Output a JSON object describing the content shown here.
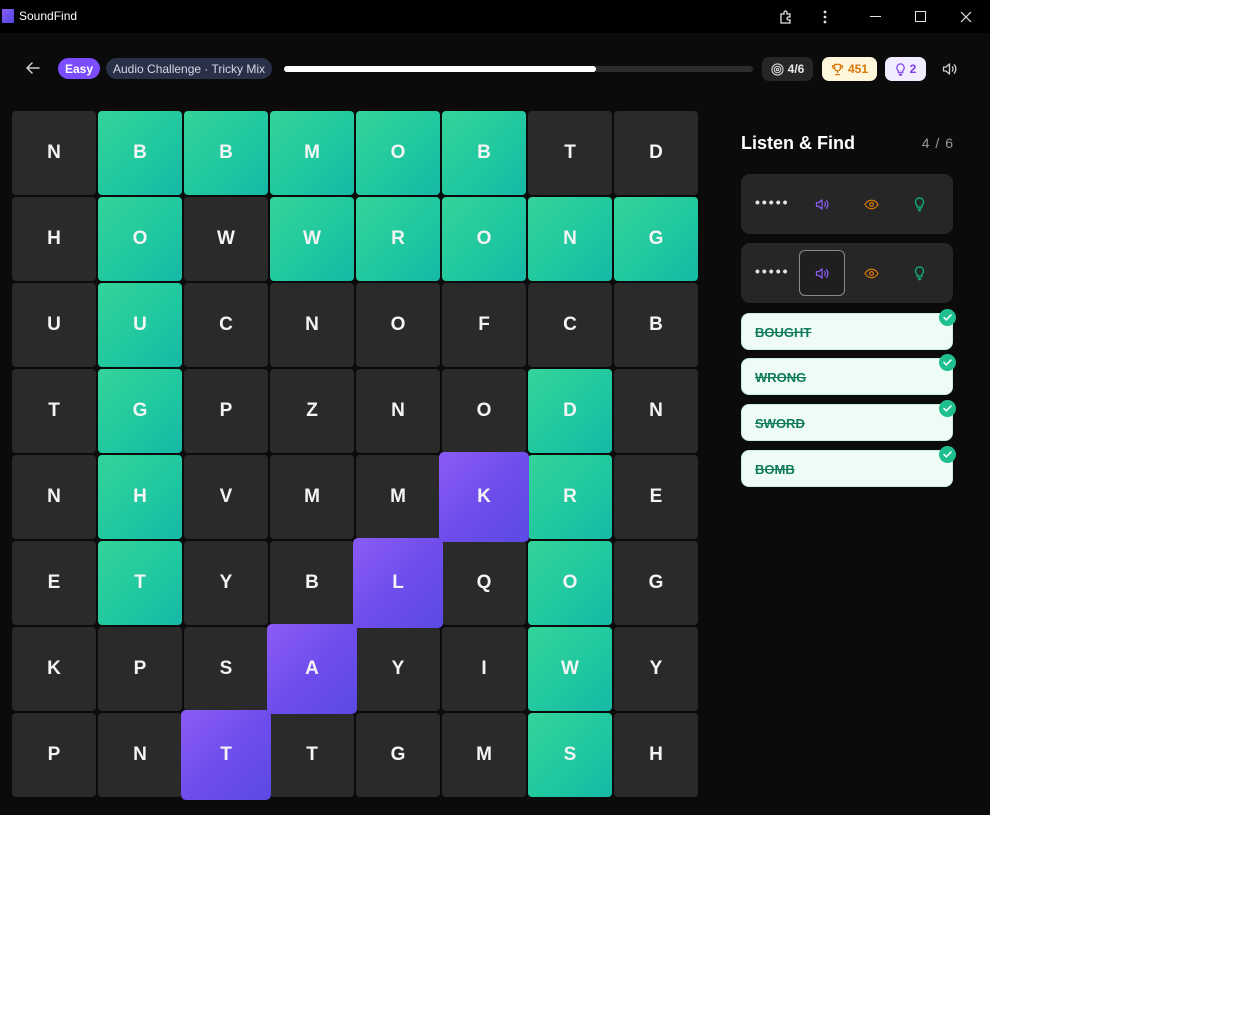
{
  "app": {
    "title": "SoundFind"
  },
  "header": {
    "difficulty": "Easy",
    "mode": "Audio Challenge · Tricky Mix",
    "progress": 0.665,
    "found_count": "4/6",
    "score": "451",
    "hints": "2"
  },
  "panel": {
    "title": "Listen & Find",
    "count": "4 / 6",
    "clues": [
      {
        "mask": "•••••"
      },
      {
        "mask": "•••••"
      }
    ],
    "words": [
      {
        "label": "BOUGHT"
      },
      {
        "label": "WRONG"
      },
      {
        "label": "SWORD"
      },
      {
        "label": "BOMB"
      }
    ]
  },
  "grid": {
    "rows": [
      [
        "N",
        "B",
        "B",
        "M",
        "O",
        "B",
        "T",
        "D"
      ],
      [
        "H",
        "O",
        "W",
        "W",
        "R",
        "O",
        "N",
        "G"
      ],
      [
        "U",
        "U",
        "C",
        "N",
        "O",
        "F",
        "C",
        "B"
      ],
      [
        "T",
        "G",
        "P",
        "Z",
        "N",
        "O",
        "D",
        "N"
      ],
      [
        "N",
        "H",
        "V",
        "M",
        "M",
        "K",
        "R",
        "E"
      ],
      [
        "E",
        "T",
        "Y",
        "B",
        "L",
        "Q",
        "O",
        "G"
      ],
      [
        "K",
        "P",
        "S",
        "A",
        "Y",
        "I",
        "W",
        "Y"
      ],
      [
        "P",
        "N",
        "T",
        "T",
        "G",
        "M",
        "S",
        "H"
      ]
    ],
    "states": [
      [
        "n",
        "f",
        "f",
        "f",
        "f",
        "f",
        "n",
        "n"
      ],
      [
        "n",
        "f",
        "n",
        "f",
        "f",
        "f",
        "f",
        "f"
      ],
      [
        "n",
        "f",
        "n",
        "n",
        "n",
        "n",
        "n",
        "n"
      ],
      [
        "n",
        "f",
        "n",
        "n",
        "n",
        "n",
        "f",
        "n"
      ],
      [
        "n",
        "f",
        "n",
        "n",
        "n",
        "s",
        "f",
        "n"
      ],
      [
        "n",
        "f",
        "n",
        "n",
        "s",
        "n",
        "f",
        "n"
      ],
      [
        "n",
        "n",
        "n",
        "s",
        "n",
        "n",
        "f",
        "n"
      ],
      [
        "n",
        "n",
        "s",
        "n",
        "n",
        "n",
        "f",
        "n"
      ]
    ]
  },
  "colors": {
    "found": "#1fc7a0",
    "selected": "#7c4dff",
    "cell": "#2a2a2a",
    "background": "#0b0b0b"
  },
  "icons": {
    "back": "arrow-left-icon",
    "target": "target-icon",
    "trophy": "trophy-icon",
    "hint": "lightbulb-icon",
    "sound": "speaker-icon",
    "reveal": "eye-icon",
    "check": "check-icon"
  }
}
